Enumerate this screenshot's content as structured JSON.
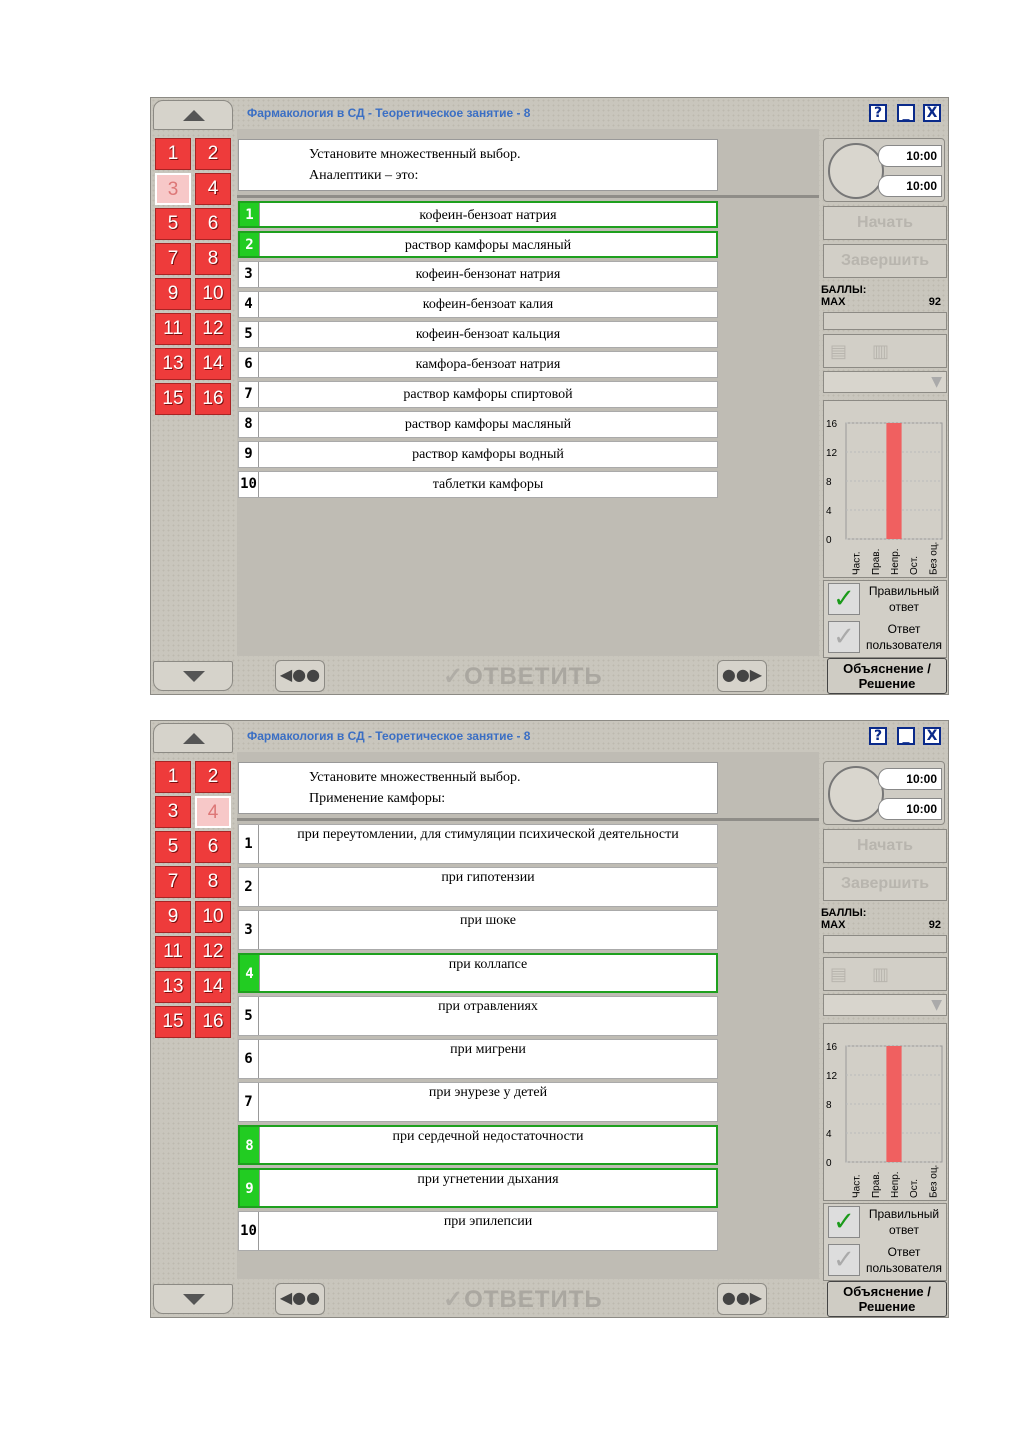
{
  "window": {
    "title": "Фармакология в СД - Теоретическое занятие - 8",
    "help_label": "?",
    "minimize_label": "_",
    "close_label": "X"
  },
  "question_numbers": [
    "1",
    "2",
    "3",
    "4",
    "5",
    "6",
    "7",
    "8",
    "9",
    "10",
    "11",
    "12",
    "13",
    "14",
    "15",
    "16"
  ],
  "timer": {
    "time1": "10:00",
    "time2": "10:00"
  },
  "controls": {
    "start_label": "Начать",
    "finish_label": "Завершить",
    "answer_label": "ОТВЕТИТЬ",
    "explain_label_line1": "Объяснение /",
    "explain_label_line2": "Решение"
  },
  "score": {
    "label": "БАЛЛЫ:",
    "max_label": "MAX",
    "max_value": "92"
  },
  "legend": {
    "correct_line1": "Правильный",
    "correct_line2": "ответ",
    "user_line1": "Ответ",
    "user_line2": "пользователя"
  },
  "chart_data": {
    "type": "bar",
    "categories": [
      "Част.",
      "Прав.",
      "Непр.",
      "Ост.",
      "Без оц."
    ],
    "values": [
      0,
      0,
      16,
      0,
      0
    ],
    "ylim": [
      0,
      16
    ],
    "yticks": [
      "16",
      "12",
      "8",
      "4",
      "0"
    ],
    "bar_color": "#f06060"
  },
  "screens": [
    {
      "current_question": "3",
      "question_line1": "Установите множественный выбор.",
      "question_line2": "Аналептики – это:",
      "answers": [
        {
          "n": "1",
          "text": "кофеин-бензоат натрия",
          "selected": true
        },
        {
          "n": "2",
          "text": "раствор камфоры масляный",
          "selected": true
        },
        {
          "n": "3",
          "text": "кофеин-бензонат натрия",
          "selected": false
        },
        {
          "n": "4",
          "text": "кофеин-бензоат калия",
          "selected": false
        },
        {
          "n": "5",
          "text": "кофеин-бензоат кальция",
          "selected": false
        },
        {
          "n": "6",
          "text": "камфора-бензоат натрия",
          "selected": false
        },
        {
          "n": "7",
          "text": "раствор камфоры спиртовой",
          "selected": false
        },
        {
          "n": "8",
          "text": "раствор камфоры масляный",
          "selected": false
        },
        {
          "n": "9",
          "text": "раствор камфоры водный",
          "selected": false
        },
        {
          "n": "10",
          "text": "таблетки камфоры",
          "selected": false
        }
      ]
    },
    {
      "current_question": "4",
      "question_line1": "Установите множественный выбор.",
      "question_line2": "Применение камфоры:",
      "answers": [
        {
          "n": "1",
          "text": "при переутомлении, для стимуляции психической деятельности",
          "selected": false
        },
        {
          "n": "2",
          "text": "при гипотензии",
          "selected": false
        },
        {
          "n": "3",
          "text": "при шоке",
          "selected": false
        },
        {
          "n": "4",
          "text": "при коллапсе",
          "selected": true
        },
        {
          "n": "5",
          "text": "при отравлениях",
          "selected": false
        },
        {
          "n": "6",
          "text": "при мигрени",
          "selected": false
        },
        {
          "n": "7",
          "text": "при энурезе  у  детей",
          "selected": false
        },
        {
          "n": "8",
          "text": "при сердечной недостаточности",
          "selected": true
        },
        {
          "n": "9",
          "text": "при угнетении дыхания",
          "selected": true
        },
        {
          "n": "10",
          "text": "при  эпилепсии",
          "selected": false
        }
      ]
    }
  ]
}
